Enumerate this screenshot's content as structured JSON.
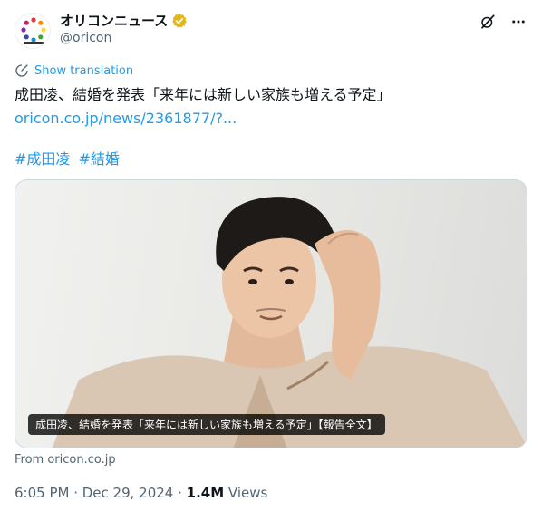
{
  "account": {
    "display_name": "オリコンニュース",
    "handle": "@oricon",
    "avatar_icon": "oricon-news-logo",
    "verified_icon": "gold-verified-badge-icon"
  },
  "actions": {
    "grok_icon": "grok-icon",
    "more_icon": "more-icon"
  },
  "translate": {
    "label": "Show translation",
    "icon": "translate-icon"
  },
  "tweet": {
    "text": "成田凌、結婚を発表「来年には新しい家族も増える予定」",
    "link": "oricon.co.jp/news/2361877/?...",
    "hashtags": [
      "#成田凌",
      "#結婚"
    ]
  },
  "card": {
    "caption": "成田凌、結婚を発表「来年には新しい家族も増える予定」【報告全文】",
    "source": "From oricon.co.jp"
  },
  "meta": {
    "time_date": "6:05 PM · Dec 29, 2024 · ",
    "views_count": "1.4M",
    "views_label": " Views"
  },
  "colors": {
    "accent": "#1d9bf0",
    "secondary_text": "#536471",
    "badge_gold": "#e2b719"
  }
}
